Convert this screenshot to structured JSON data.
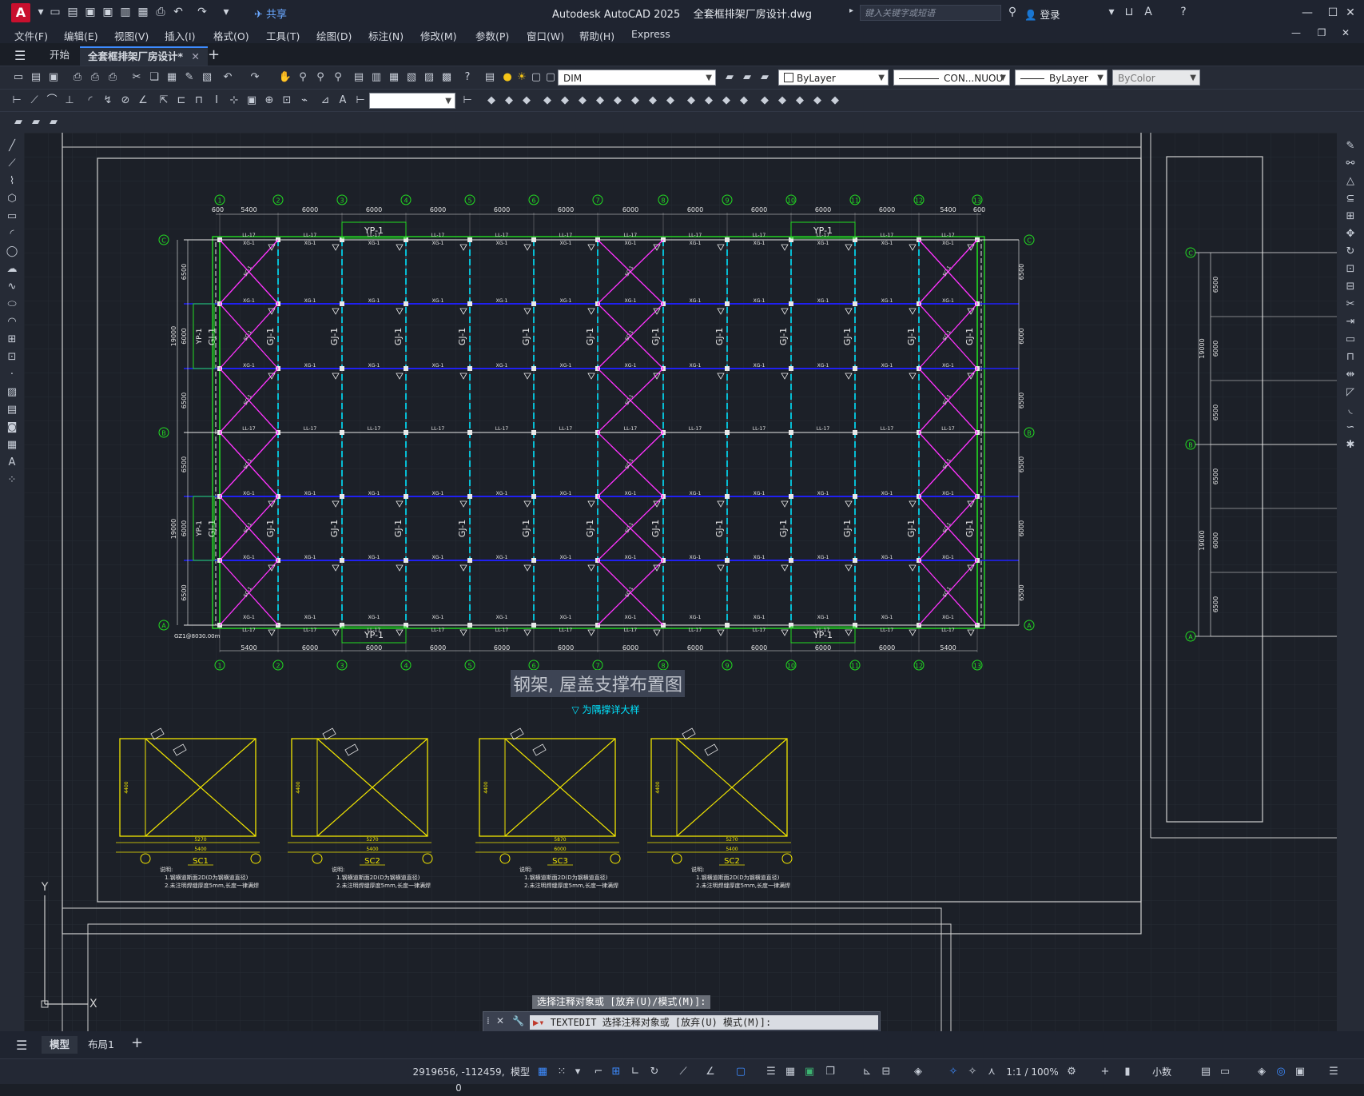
{
  "app": {
    "title": "Autodesk AutoCAD 2025",
    "document": "全套框排架厂房设计.dwg",
    "share_label": "共享",
    "search_placeholder": "键入关键字或短语",
    "login_label": "登录"
  },
  "menu": [
    "文件(F)",
    "编辑(E)",
    "视图(V)",
    "插入(I)",
    "格式(O)",
    "工具(T)",
    "绘图(D)",
    "标注(N)",
    "修改(M)",
    "参数(P)",
    "窗口(W)",
    "帮助(H)",
    "Express"
  ],
  "tabs": {
    "start": "开始",
    "drawing": "全套框排架厂房设计*"
  },
  "toolbar": {
    "dimstyle": "DIM",
    "layer_color": "ByLayer",
    "linetype": "CON...NUOU",
    "lineweight": "ByLayer",
    "plotstyle": "ByColor"
  },
  "drawing": {
    "plan_title": "钢架, 屋盖支撑布置图",
    "plan_subtitle": "▽ 为隅撑详大样",
    "axis_numbers": [
      "1",
      "2",
      "3",
      "4",
      "5",
      "6",
      "7",
      "8",
      "9",
      "10",
      "11",
      "12",
      "13"
    ],
    "axis_letters": [
      "C",
      "B",
      "A"
    ],
    "top_dims": [
      "600",
      "5400",
      "6000",
      "6000",
      "6000",
      "6000",
      "6000",
      "6000",
      "6000",
      "6000",
      "6000",
      "6000",
      "5400",
      "600"
    ],
    "bottom_dims": [
      "5400",
      "6000",
      "6000",
      "6000",
      "6000",
      "6000",
      "6000",
      "6000",
      "6000",
      "6000",
      "6000",
      "5400"
    ],
    "left_dims": [
      "6500",
      "6000",
      "6500",
      "6500",
      "6000",
      "6500"
    ],
    "left_totals": [
      "19000",
      "19000"
    ],
    "right_dims": [
      "6500",
      "6000",
      "6500",
      "6500",
      "6000",
      "6500"
    ],
    "frame_label": "GJ-1",
    "purlin_label": "XG-1",
    "tie_label": "LL-17",
    "brace_label": "SC-1",
    "yp_label": "YP-1",
    "column_note": "GZ1@8030.00m",
    "details": [
      {
        "name": "SC1",
        "note1": "说明:",
        "note2": "1.钢横道斯面2D(D为钢横道直径)",
        "note3": "2.未注明焊缝厚度5mm,长度一律满焊",
        "dim_w": "5270",
        "dim_total": "5400",
        "dim_h": "4400"
      },
      {
        "name": "SC2",
        "note1": "说明:",
        "note2": "1.钢横道斯面2D(D为钢横道直径)",
        "note3": "2.未注明焊缝厚度5mm,长度一律满焊",
        "dim_w": "5270",
        "dim_total": "5400",
        "dim_h": "4400"
      },
      {
        "name": "SC3",
        "note1": "说明:",
        "note2": "1.钢横道斯面2D(D为钢横道直径)",
        "note3": "2.未注明焊缝厚度5mm,长度一律满焊",
        "dim_w": "5870",
        "dim_total": "6000",
        "dim_h": "4400"
      },
      {
        "name": "SC2",
        "note1": "说明:",
        "note2": "1.钢横道斯面2D(D为钢横道直径)",
        "note3": "2.未注明焊缝厚度5mm,长度一律满焊",
        "dim_w": "5270",
        "dim_total": "5400",
        "dim_h": "4400"
      }
    ],
    "right_axis": [
      "C",
      "B",
      "A"
    ],
    "right_totals": [
      "19000",
      "19000"
    ]
  },
  "command": {
    "history": "选择注释对象或 [放弃(U)/模式(M)]:",
    "prompt": "TEXTEDIT 选择注释对象或 [放弃(U) 模式(M)]:"
  },
  "layout_tabs": {
    "model": "模型",
    "layout1": "布局1"
  },
  "status": {
    "coords": "2919656, -112459, 0",
    "space": "模型",
    "scale": "1:1 / 100%",
    "units": "小数"
  }
}
